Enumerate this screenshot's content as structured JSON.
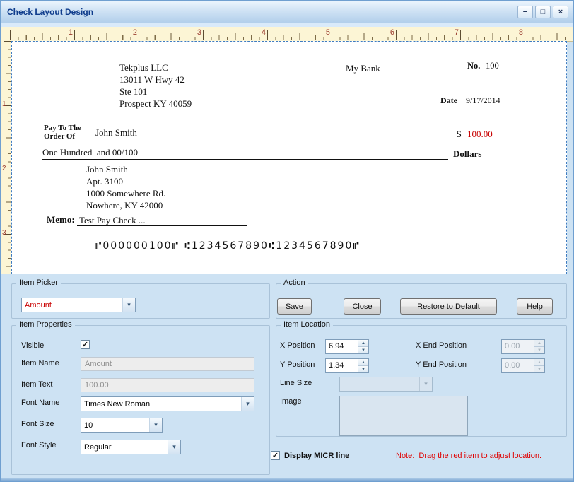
{
  "window": {
    "title": "Check Layout Design",
    "buttons": {
      "minimize": "−",
      "maximize": "□",
      "close": "×"
    }
  },
  "ruler": {
    "h": [
      "1",
      "2",
      "3",
      "4",
      "5",
      "6",
      "7",
      "8"
    ],
    "v": [
      "1",
      "2",
      "3"
    ]
  },
  "check": {
    "company_lines": [
      "Tekplus LLC",
      "13011 W Hwy 42",
      "Ste 101",
      "Prospect KY 40059"
    ],
    "bank_name": "My Bank",
    "no_label": "No.",
    "no_value": "100",
    "date_label": "Date",
    "date_value": "9/17/2014",
    "pay_to_line1": "Pay To The",
    "pay_to_line2": "Order Of",
    "payee_name": "John Smith",
    "dollar_sign": "$",
    "amount": "100.00",
    "amount_words": "One Hundred  and 00/100",
    "dollars_label": "Dollars",
    "address_lines": [
      "John Smith",
      "Apt. 3100",
      "1000 Somewhere Rd.",
      "Nowhere, KY 42000"
    ],
    "memo_label": "Memo:",
    "memo_value": "Test Pay Check ...",
    "micr": "⑈000000100⑈  ⑆1234567890⑆1234567890⑈"
  },
  "item_picker": {
    "group_label": "Item Picker",
    "value": "Amount"
  },
  "item_properties": {
    "group_label": "Item Properties",
    "visible_label": "Visible",
    "item_name_label": "Item Name",
    "item_name_value": "Amount",
    "item_text_label": "Item Text",
    "item_text_value": "100.00",
    "font_name_label": "Font Name",
    "font_name_value": "Times New Roman",
    "font_size_label": "Font Size",
    "font_size_value": "10",
    "font_style_label": "Font Style",
    "font_style_value": "Regular"
  },
  "action": {
    "group_label": "Action",
    "save": "Save",
    "close": "Close",
    "restore": "Restore to Default",
    "help": "Help"
  },
  "item_location": {
    "group_label": "Item Location",
    "x_label": "X Position",
    "x_value": "6.94",
    "x_end_label": "X End Position",
    "x_end_value": "0.00",
    "y_label": "Y Position",
    "y_value": "1.34",
    "y_end_label": "Y End Position",
    "y_end_value": "0.00",
    "line_size_label": "Line Size",
    "image_label": "Image"
  },
  "footer": {
    "micr_label": "Display MICR line",
    "note": "Note:  Drag the red item to adjust location."
  },
  "colors": {
    "selected_item_red": "#c80000",
    "note_red": "#e00000",
    "panel_bg": "#cde2f3",
    "ruler_bg": "#fcf5d5",
    "title_text": "#0f3c8c"
  }
}
